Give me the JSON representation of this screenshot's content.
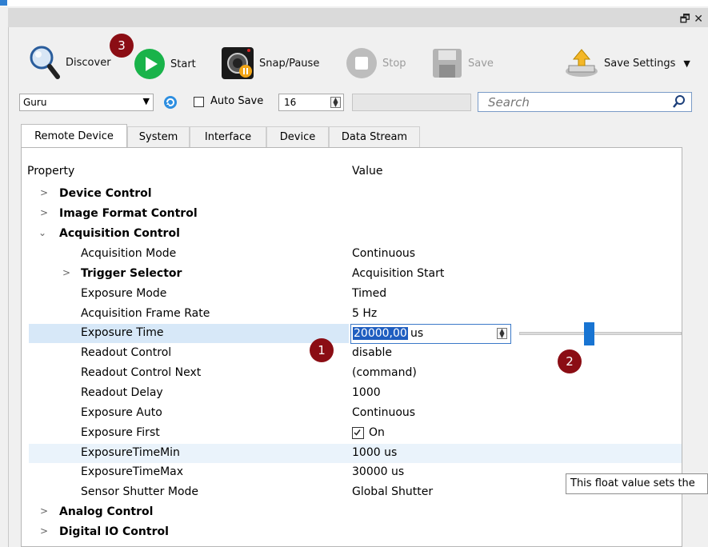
{
  "window": {
    "dock_controls": "🗗 ✕"
  },
  "toolbar": {
    "discover": "Discover",
    "start": "Start",
    "snap_pause": "Snap/Pause",
    "stop": "Stop",
    "save": "Save",
    "save_settings": "Save Settings"
  },
  "filterbar": {
    "device_combo": "Guru",
    "auto_save_label": "Auto Save",
    "auto_save_checked": false,
    "count_value": "16",
    "search_placeholder": "Search"
  },
  "tabs": [
    {
      "label": "Remote Device",
      "active": true
    },
    {
      "label": "System",
      "active": false
    },
    {
      "label": "Interface",
      "active": false
    },
    {
      "label": "Device",
      "active": false
    },
    {
      "label": "Data Stream",
      "active": false
    }
  ],
  "grid": {
    "col_property": "Property",
    "col_value": "Value",
    "rows": [
      {
        "name": "Device Control",
        "value": "",
        "group": true,
        "expanded": false
      },
      {
        "name": "Image Format Control",
        "value": "",
        "group": true,
        "expanded": false
      },
      {
        "name": "Acquisition Control",
        "value": "",
        "group": true,
        "expanded": true
      },
      {
        "name": "Acquisition Mode",
        "value": "Continuous"
      },
      {
        "name": "Trigger Selector",
        "value": "Acquisition Start",
        "subgroup": true
      },
      {
        "name": "Exposure Mode",
        "value": "Timed"
      },
      {
        "name": "Acquisition Frame Rate",
        "value": "5 Hz"
      },
      {
        "name": "Exposure Time",
        "value": "20000,00us",
        "selected": true
      },
      {
        "name": "Readout Control",
        "value": "disable"
      },
      {
        "name": "Readout Control Next",
        "value": "(command)"
      },
      {
        "name": "Readout Delay",
        "value": "1000"
      },
      {
        "name": "Exposure Auto",
        "value": "Continuous"
      },
      {
        "name": "Exposure First",
        "value": "On",
        "checkbox": true
      },
      {
        "name": "ExposureTimeMin",
        "value": "1000 us",
        "highlight": true
      },
      {
        "name": "ExposureTimeMax",
        "value": "30000 us"
      },
      {
        "name": "Sensor Shutter Mode",
        "value": "Global Shutter"
      },
      {
        "name": "Analog Control",
        "value": "",
        "group": true,
        "expanded": false
      },
      {
        "name": "Digital IO Control",
        "value": "",
        "group": true,
        "expanded": false
      }
    ]
  },
  "editor": {
    "selected_text": "20000,00",
    "unit": "us"
  },
  "slider": {
    "fraction": 0.4
  },
  "badges": {
    "one": "1",
    "two": "2",
    "three": "3"
  },
  "tooltip": {
    "text": "This float value sets the"
  },
  "colors": {
    "start_green": "#19b34a",
    "badge_red": "#8b0d14",
    "selection": "#1f5ec0",
    "slider": "#1874d2"
  }
}
